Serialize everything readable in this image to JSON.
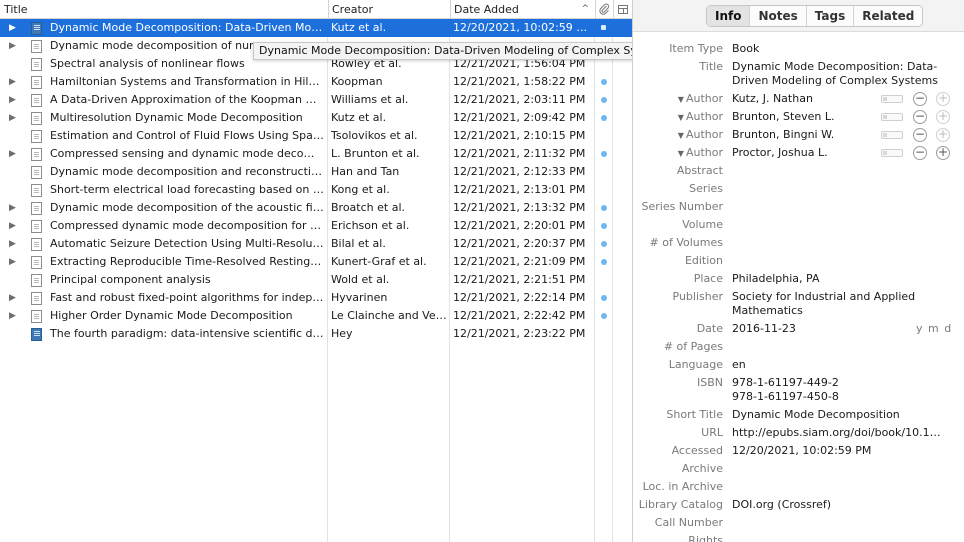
{
  "columns": {
    "title": "Title",
    "creator": "Creator",
    "date_added": "Date Added",
    "sort_indicator": "^",
    "attachments_icon": "paperclip-icon",
    "notes_icon": "notes-column-icon"
  },
  "tooltip": "Dynamic Mode Decomposition: Data-Driven Modeling of Complex Systems",
  "items": [
    {
      "title": "Dynamic Mode Decomposition: Data-Driven Mod…",
      "creator": "Kutz et al.",
      "added": "12/20/2021, 10:02:59 …",
      "type": "book",
      "expandable": true,
      "attachment": true,
      "selected": true
    },
    {
      "title": "Dynamic mode decomposition of num",
      "creator": "",
      "added": "",
      "type": "document",
      "expandable": true,
      "attachment": false,
      "selected": false
    },
    {
      "title": "Spectral analysis of nonlinear flows",
      "creator": "Rowley et al.",
      "added": "12/21/2021, 1:56:04 PM",
      "type": "document",
      "expandable": false,
      "attachment": false,
      "selected": false
    },
    {
      "title": "Hamiltonian Systems and Transformation in Hilb…",
      "creator": "Koopman",
      "added": "12/21/2021, 1:58:22 PM",
      "type": "document",
      "expandable": true,
      "attachment": true,
      "selected": false
    },
    {
      "title": "A Data-Driven Approximation of the Koopman O…",
      "creator": "Williams et al.",
      "added": "12/21/2021, 2:03:11 PM",
      "type": "document",
      "expandable": true,
      "attachment": true,
      "selected": false
    },
    {
      "title": "Multiresolution Dynamic Mode Decomposition",
      "creator": "Kutz et al.",
      "added": "12/21/2021, 2:09:42 PM",
      "type": "document",
      "expandable": true,
      "attachment": true,
      "selected": false
    },
    {
      "title": "Estimation and Control of Fluid Flows Using Spar…",
      "creator": "Tsolovikos et al.",
      "added": "12/21/2021, 2:10:15 PM",
      "type": "document",
      "expandable": false,
      "attachment": false,
      "selected": false
    },
    {
      "title": "Compressed sensing and dynamic mode decomp…",
      "creator": "L. Brunton et al.",
      "added": "12/21/2021, 2:11:32 PM",
      "type": "document",
      "expandable": true,
      "attachment": true,
      "selected": false
    },
    {
      "title": "Dynamic mode decomposition and reconstructio…",
      "creator": "Han and Tan",
      "added": "12/21/2021, 2:12:33 PM",
      "type": "document",
      "expandable": false,
      "attachment": false,
      "selected": false
    },
    {
      "title": "Short-term electrical load forecasting based on e…",
      "creator": "Kong et al.",
      "added": "12/21/2021, 2:13:01 PM",
      "type": "document",
      "expandable": false,
      "attachment": false,
      "selected": false
    },
    {
      "title": "Dynamic mode decomposition of the acoustic fiel…",
      "creator": "Broatch et al.",
      "added": "12/21/2021, 2:13:32 PM",
      "type": "document",
      "expandable": true,
      "attachment": true,
      "selected": false
    },
    {
      "title": "Compressed dynamic mode decomposition for b…",
      "creator": "Erichson et al.",
      "added": "12/21/2021, 2:20:01 PM",
      "type": "document",
      "expandable": true,
      "attachment": true,
      "selected": false
    },
    {
      "title": "Automatic Seizure Detection Using Multi-Resoluti…",
      "creator": "Bilal et al.",
      "added": "12/21/2021, 2:20:37 PM",
      "type": "document",
      "expandable": true,
      "attachment": true,
      "selected": false
    },
    {
      "title": "Extracting Reproducible Time-Resolved Resting S…",
      "creator": "Kunert-Graf et al.",
      "added": "12/21/2021, 2:21:09 PM",
      "type": "document",
      "expandable": true,
      "attachment": true,
      "selected": false
    },
    {
      "title": "Principal component analysis",
      "creator": "Wold et al.",
      "added": "12/21/2021, 2:21:51 PM",
      "type": "document",
      "expandable": false,
      "attachment": false,
      "selected": false
    },
    {
      "title": "Fast and robust fixed-point algorithms for indep…",
      "creator": "Hyvarinen",
      "added": "12/21/2021, 2:22:14 PM",
      "type": "document",
      "expandable": true,
      "attachment": true,
      "selected": false
    },
    {
      "title": "Higher Order Dynamic Mode Decomposition",
      "creator": "Le Clainche and Vega",
      "added": "12/21/2021, 2:22:42 PM",
      "type": "document",
      "expandable": true,
      "attachment": true,
      "selected": false
    },
    {
      "title": "The fourth paradigm: data-intensive scientific di…",
      "creator": "Hey",
      "added": "12/21/2021, 2:23:22 PM",
      "type": "book",
      "expandable": false,
      "attachment": false,
      "selected": false
    }
  ],
  "tabs": [
    {
      "label": "Info",
      "active": true
    },
    {
      "label": "Notes",
      "active": false
    },
    {
      "label": "Tags",
      "active": false
    },
    {
      "label": "Related",
      "active": false
    }
  ],
  "fields": [
    {
      "kind": "field",
      "label": "Item Type",
      "value": "Book"
    },
    {
      "kind": "field",
      "label": "Title",
      "value": "Dynamic Mode Decomposition: Data-Driven Modeling of Complex Systems",
      "lines": 2
    },
    {
      "kind": "author",
      "label": "Author",
      "value": "Kutz, J. Nathan",
      "plus_enabled": false
    },
    {
      "kind": "author",
      "label": "Author",
      "value": "Brunton, Steven L.",
      "plus_enabled": false
    },
    {
      "kind": "author",
      "label": "Author",
      "value": "Brunton, Bingni W.",
      "plus_enabled": false
    },
    {
      "kind": "author",
      "label": "Author",
      "value": "Proctor, Joshua L.",
      "plus_enabled": true
    },
    {
      "kind": "field",
      "label": "Abstract",
      "value": ""
    },
    {
      "kind": "field",
      "label": "Series",
      "value": ""
    },
    {
      "kind": "field",
      "label": "Series Number",
      "value": ""
    },
    {
      "kind": "field",
      "label": "Volume",
      "value": ""
    },
    {
      "kind": "field",
      "label": "# of Volumes",
      "value": ""
    },
    {
      "kind": "field",
      "label": "Edition",
      "value": ""
    },
    {
      "kind": "field",
      "label": "Place",
      "value": "Philadelphia, PA"
    },
    {
      "kind": "field",
      "label": "Publisher",
      "value": "Society for Industrial and Applied Mathematics",
      "lines": 2
    },
    {
      "kind": "date",
      "label": "Date",
      "value": "2016-11-23",
      "hint": "y m d"
    },
    {
      "kind": "field",
      "label": "# of Pages",
      "value": ""
    },
    {
      "kind": "field",
      "label": "Language",
      "value": "en"
    },
    {
      "kind": "field",
      "label": "ISBN",
      "value": "978-1-61197-449-2\n978-1-61197-450-8",
      "lines": 2
    },
    {
      "kind": "field",
      "label": "Short Title",
      "value": "Dynamic Mode Decomposition"
    },
    {
      "kind": "url",
      "label": "URL",
      "value": "http://epubs.siam.org/doi/book/10.1…"
    },
    {
      "kind": "field",
      "label": "Accessed",
      "value": "12/20/2021, 10:02:59 PM"
    },
    {
      "kind": "field",
      "label": "Archive",
      "value": ""
    },
    {
      "kind": "field",
      "label": "Loc. in Archive",
      "value": ""
    },
    {
      "kind": "field",
      "label": "Library Catalog",
      "value": "DOI.org (Crossref)"
    },
    {
      "kind": "field",
      "label": "Call Number",
      "value": ""
    },
    {
      "kind": "field",
      "label": "Rights",
      "value": ""
    }
  ],
  "colors": {
    "selection": "#1d6fdc",
    "attachment_dot": "#6fb6ee"
  }
}
